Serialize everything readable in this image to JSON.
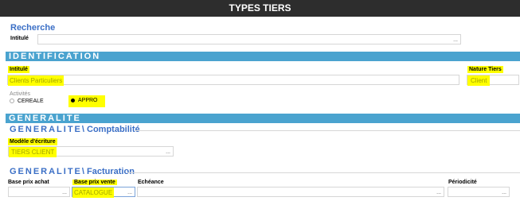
{
  "title": "TYPES TIERS",
  "recherche": {
    "heading": "Recherche",
    "intitule_label": "Intitulé",
    "intitule_value": ""
  },
  "identification": {
    "bar": "IDENTIFICATION",
    "intitule_label": "Intitulé",
    "intitule_value": "Clients Particuliers",
    "nature_label": "Nature Tiers",
    "nature_value": "Client",
    "activites_label": "Activités",
    "activites": [
      {
        "label": "CEREALE",
        "selected": false
      },
      {
        "label": "APPRO",
        "selected": true
      }
    ]
  },
  "generalite": {
    "bar": "GENERALITE",
    "comptabilite": {
      "heading_prefix": "GENERALITE",
      "heading_suffix": "\\ Comptabilité",
      "modele_label": "Modèle d'écriture",
      "modele_value": "TIERS CLIENT"
    },
    "facturation": {
      "heading_prefix": "GENERALITE",
      "heading_suffix": "\\ Facturation",
      "base_achat_label": "Base prix achat",
      "base_achat_value": "",
      "base_vente_label": "Base prix vente",
      "base_vente_value": "CATALOGUE",
      "echeance_label": "Echéance",
      "echeance_value": "",
      "periodicite_label": "Périodicité",
      "periodicite_value": ""
    }
  },
  "lookup_glyph": "..."
}
